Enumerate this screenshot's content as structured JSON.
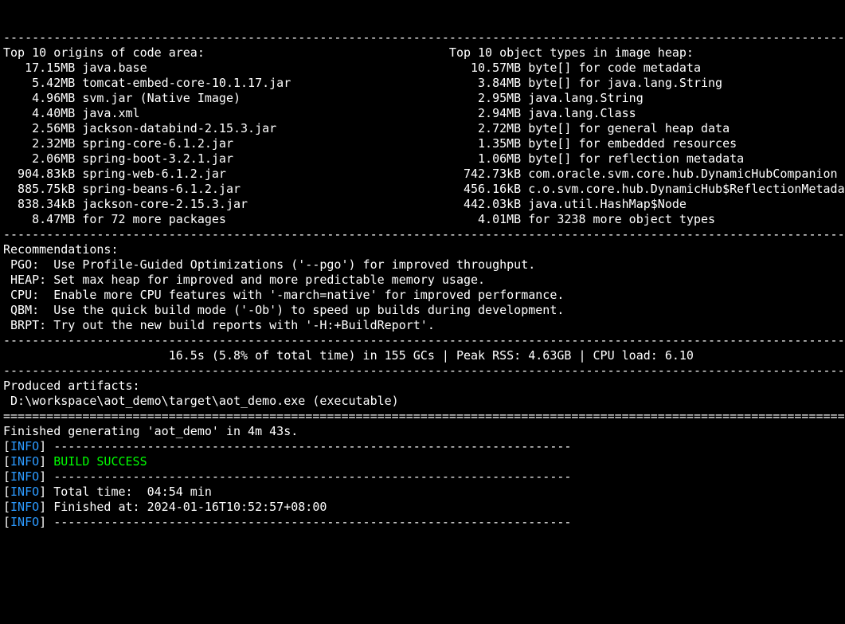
{
  "dash_line": "------------------------------------------------------------------------------------------------------------------------",
  "eq_line": "========================================================================================================================",
  "small_dash": "------------------------------------------------------------------------",
  "headers": {
    "code_area": "Top 10 origins of code area:",
    "heap": "Top 10 object types in image heap:"
  },
  "code_area": [
    {
      "size": "17.15MB",
      "label": "java.base"
    },
    {
      "size": "5.42MB",
      "label": "tomcat-embed-core-10.1.17.jar"
    },
    {
      "size": "4.96MB",
      "label": "svm.jar (Native Image)"
    },
    {
      "size": "4.40MB",
      "label": "java.xml"
    },
    {
      "size": "2.56MB",
      "label": "jackson-databind-2.15.3.jar"
    },
    {
      "size": "2.32MB",
      "label": "spring-core-6.1.2.jar"
    },
    {
      "size": "2.06MB",
      "label": "spring-boot-3.2.1.jar"
    },
    {
      "size": "904.83kB",
      "label": "spring-web-6.1.2.jar"
    },
    {
      "size": "885.75kB",
      "label": "spring-beans-6.1.2.jar"
    },
    {
      "size": "838.34kB",
      "label": "jackson-core-2.15.3.jar"
    }
  ],
  "code_area_more": {
    "size": "8.47MB",
    "label": "for 72 more packages"
  },
  "heap": [
    {
      "size": "10.57MB",
      "label": "byte[] for code metadata"
    },
    {
      "size": "3.84MB",
      "label": "byte[] for java.lang.String"
    },
    {
      "size": "2.95MB",
      "label": "java.lang.String"
    },
    {
      "size": "2.94MB",
      "label": "java.lang.Class"
    },
    {
      "size": "2.72MB",
      "label": "byte[] for general heap data"
    },
    {
      "size": "1.35MB",
      "label": "byte[] for embedded resources"
    },
    {
      "size": "1.06MB",
      "label": "byte[] for reflection metadata"
    },
    {
      "size": "742.73kB",
      "label": "com.oracle.svm.core.hub.DynamicHubCompanion"
    },
    {
      "size": "456.16kB",
      "label": "c.o.svm.core.hub.DynamicHub$ReflectionMetadata"
    },
    {
      "size": "442.03kB",
      "label": "java.util.HashMap$Node"
    }
  ],
  "heap_more": {
    "size": "4.01MB",
    "label": "for 3238 more object types"
  },
  "recommendations_title": "Recommendations:",
  "recommendations": [
    {
      "key": "PGO:",
      "text": "Use Profile-Guided Optimizations ('--pgo') for improved throughput."
    },
    {
      "key": "HEAP:",
      "text": "Set max heap for improved and more predictable memory usage."
    },
    {
      "key": "CPU:",
      "text": "Enable more CPU features with '-march=native' for improved performance."
    },
    {
      "key": "QBM:",
      "text": "Use the quick build mode ('-Ob') to speed up builds during development."
    },
    {
      "key": "BRPT:",
      "text": "Try out the new build reports with '-H:+BuildReport'."
    }
  ],
  "gc_line": "16.5s (5.8% of total time) in 155 GCs | Peak RSS: 4.63GB | CPU load: 6.10",
  "produced_artifacts_title": "Produced artifacts:",
  "produced_artifact": " D:\\workspace\\aot_demo\\target\\aot_demo.exe (executable)",
  "finished_line": "Finished generating 'aot_demo' in 4m 43s.",
  "maven": {
    "tag": "INFO",
    "build_success": "BUILD SUCCESS",
    "total_time": "Total time:  04:54 min",
    "finished_at": "Finished at: 2024-01-16T10:52:57+08:00"
  }
}
